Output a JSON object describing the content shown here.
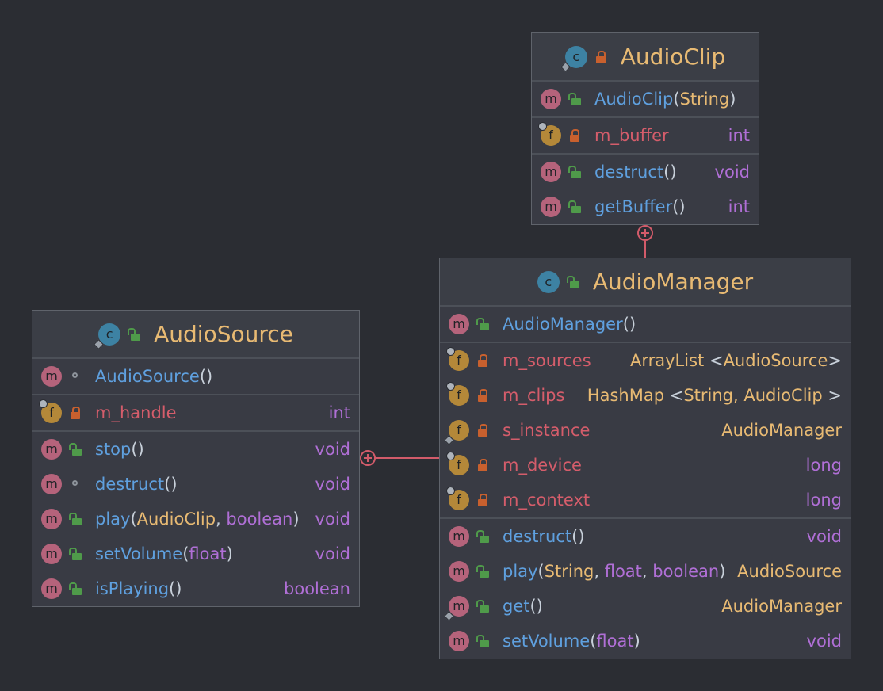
{
  "audio_clip": {
    "name": "AudioClip",
    "class_icon_letter": "c",
    "constructor": {
      "name": "AudioClip",
      "param": "String"
    },
    "field": {
      "name": "m_buffer",
      "type": "int"
    },
    "methods": [
      {
        "name": "destruct",
        "parens": "()",
        "ret": "void"
      },
      {
        "name": "getBuffer",
        "parens": "()",
        "ret": "int"
      }
    ]
  },
  "audio_manager": {
    "name": "AudioManager",
    "class_icon_letter": "c",
    "constructor": {
      "name": "AudioManager",
      "parens": "()"
    },
    "fields": [
      {
        "name": "m_sources",
        "type": "ArrayList",
        "generic_open": "<",
        "generic_arg": "AudioSource",
        "generic_close": ">"
      },
      {
        "name": "m_clips",
        "type": "HashMap",
        "generic_open": "<",
        "generic_arg": "String, AudioClip",
        "generic_close": ">"
      },
      {
        "name": "s_instance",
        "type": "AudioManager"
      },
      {
        "name": "m_device",
        "type": "long"
      },
      {
        "name": "m_context",
        "type": "long"
      }
    ],
    "methods": [
      {
        "name": "destruct",
        "parens": "()",
        "ret": "void"
      },
      {
        "name": "play",
        "open": "(",
        "p1": "String",
        "sep1": ",",
        "p2": "float",
        "sep2": ",",
        "p3": "boolean",
        "close": ")",
        "ret": "AudioSource"
      },
      {
        "name": "get",
        "parens": "()",
        "ret": "AudioManager"
      },
      {
        "name": "setVolume",
        "open": "(",
        "p1": "float",
        "close": ")",
        "ret": "void"
      }
    ]
  },
  "audio_source": {
    "name": "AudioSource",
    "class_icon_letter": "c",
    "constructor": {
      "name": "AudioSource",
      "parens": "()"
    },
    "field": {
      "name": "m_handle",
      "type": "int"
    },
    "methods": [
      {
        "name": "stop",
        "parens": "()",
        "ret": "void"
      },
      {
        "name": "destruct",
        "parens": "()",
        "ret": "void"
      },
      {
        "name": "play",
        "open": "(",
        "p1": "AudioClip",
        "sep1": ",",
        "p2": "boolean",
        "close": ")",
        "ret": "void"
      },
      {
        "name": "setVolume",
        "open": "(",
        "p1": "float",
        "close": ")",
        "ret": "void"
      },
      {
        "name": "isPlaying",
        "parens": "()",
        "ret": "boolean"
      }
    ]
  },
  "badges": {
    "method": "m",
    "field": "f"
  },
  "colors": {
    "background": "#2b2d33",
    "class_name": "#e8ba73",
    "method_name": "#5fa0df",
    "field_name": "#d55d6b",
    "primitive_type": "#b06fd6",
    "connector": "#d25b6a"
  }
}
